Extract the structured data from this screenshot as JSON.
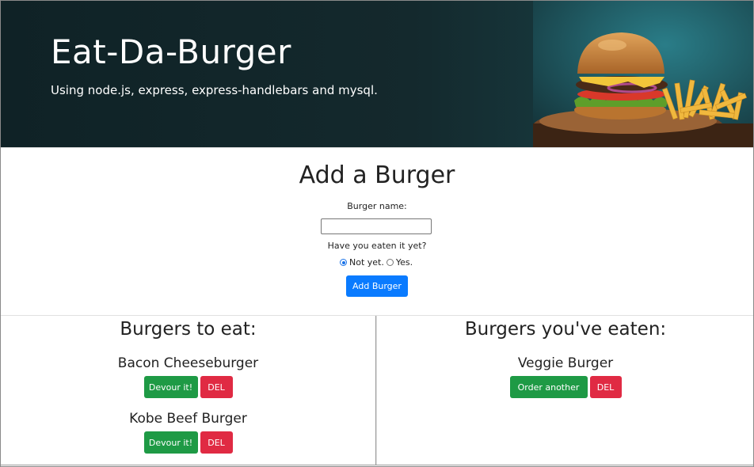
{
  "hero": {
    "title": "Eat-Da-Burger",
    "subtitle": "Using node.js, express, express-handlebars and mysql."
  },
  "add_form": {
    "title": "Add a Burger",
    "name_label": "Burger name:",
    "name_value": "",
    "eaten_question": "Have you eaten it yet?",
    "options": [
      {
        "label": "Not yet.",
        "selected": true
      },
      {
        "label": "Yes.",
        "selected": false
      }
    ],
    "submit_label": "Add Burger"
  },
  "to_eat": {
    "title": "Burgers to eat:",
    "items": [
      {
        "name": "Bacon Cheeseburger",
        "action_label": "Devour it!",
        "delete_label": "DEL"
      },
      {
        "name": "Kobe Beef Burger",
        "action_label": "Devour it!",
        "delete_label": "DEL"
      }
    ]
  },
  "eaten": {
    "title": "Burgers you've eaten:",
    "items": [
      {
        "name": "Veggie Burger",
        "action_label": "Order another",
        "delete_label": "DEL"
      }
    ]
  },
  "colors": {
    "primary": "#0a7bff",
    "success": "#1e9a45",
    "danger": "#e02a43",
    "hero_bg": "#12262a"
  },
  "icons": [
    "radio-button-icon"
  ]
}
